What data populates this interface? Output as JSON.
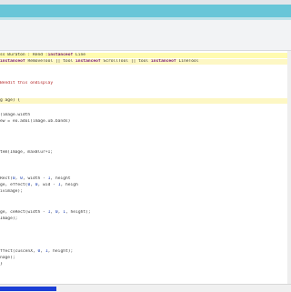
{
  "editor": {
    "lines": [
      {
        "segments": [
          {
            "t": "plain",
            "v": "ss Buraton : Rend :"
          },
          {
            "t": "kw",
            "v": "instanceof"
          },
          {
            "t": "plain",
            "v": " Line"
          }
        ]
      },
      {
        "segments": [
          {
            "t": "kw",
            "v": "instanceof"
          },
          {
            "t": "plain",
            "v": " RemoveTool || tool "
          },
          {
            "t": "kw",
            "v": "instanceof"
          },
          {
            "t": "plain",
            "v": " ScrollTool || tool "
          },
          {
            "t": "kw",
            "v": "instanceof"
          },
          {
            "t": "plain",
            "v": " LineTool"
          }
        ]
      },
      {
        "segments": [
          {
            "t": "str",
            "v": "Bendit this ondisplay"
          }
        ]
      },
      {
        "segments": [
          {
            "t": "plain",
            "v": "g age) {"
          }
        ]
      },
      {
        "segments": [
          {
            "t": "plain",
            "v": "(image.width"
          }
        ]
      },
      {
        "segments": [
          {
            "t": "plain",
            "v": "ew = eo.adoi(image.ub.bands)"
          }
        ]
      },
      {
        "segments": [
          {
            "t": "plain",
            "v": "tem(Image, maxBlur+1;"
          }
        ]
      },
      {
        "segments": [
          {
            "t": "plain",
            "v": "Rect("
          },
          {
            "t": "num",
            "v": "0"
          },
          {
            "t": "plain",
            "v": ", "
          },
          {
            "t": "num",
            "v": "0"
          },
          {
            "t": "plain",
            "v": ", width - "
          },
          {
            "t": "num",
            "v": "1"
          },
          {
            "t": "plain",
            "v": ", height"
          }
        ]
      },
      {
        "segments": [
          {
            "t": "plain",
            "v": "ge, effect("
          },
          {
            "t": "num",
            "v": "0"
          },
          {
            "t": "plain",
            "v": ", "
          },
          {
            "t": "num",
            "v": "0"
          },
          {
            "t": "plain",
            "v": ", wid - "
          },
          {
            "t": "num",
            "v": "1"
          },
          {
            "t": "plain",
            "v": ", heigh"
          }
        ]
      },
      {
        "segments": [
          {
            "t": "plain",
            "v": "ivimage);"
          }
        ]
      },
      {
        "segments": [
          {
            "t": "plain",
            "v": "ge, ceRect(width - "
          },
          {
            "t": "num",
            "v": "1"
          },
          {
            "t": "plain",
            "v": ", "
          },
          {
            "t": "num",
            "v": "0"
          },
          {
            "t": "plain",
            "v": ", "
          },
          {
            "t": "num",
            "v": "1"
          },
          {
            "t": "plain",
            "v": ", height);"
          }
        ]
      },
      {
        "segments": [
          {
            "t": "plain",
            "v": "Image);"
          }
        ]
      },
      {
        "segments": [
          {
            "t": "plain",
            "v": "ffect(cuscenX, "
          },
          {
            "t": "num",
            "v": "0"
          },
          {
            "t": "plain",
            "v": ", "
          },
          {
            "t": "num",
            "v": "1"
          },
          {
            "t": "plain",
            "v": ", height);"
          }
        ]
      },
      {
        "segments": [
          {
            "t": "plain",
            "v": "nage);"
          }
        ]
      },
      {
        "segments": [
          {
            "t": "plain",
            "v": "}"
          }
        ]
      }
    ]
  }
}
